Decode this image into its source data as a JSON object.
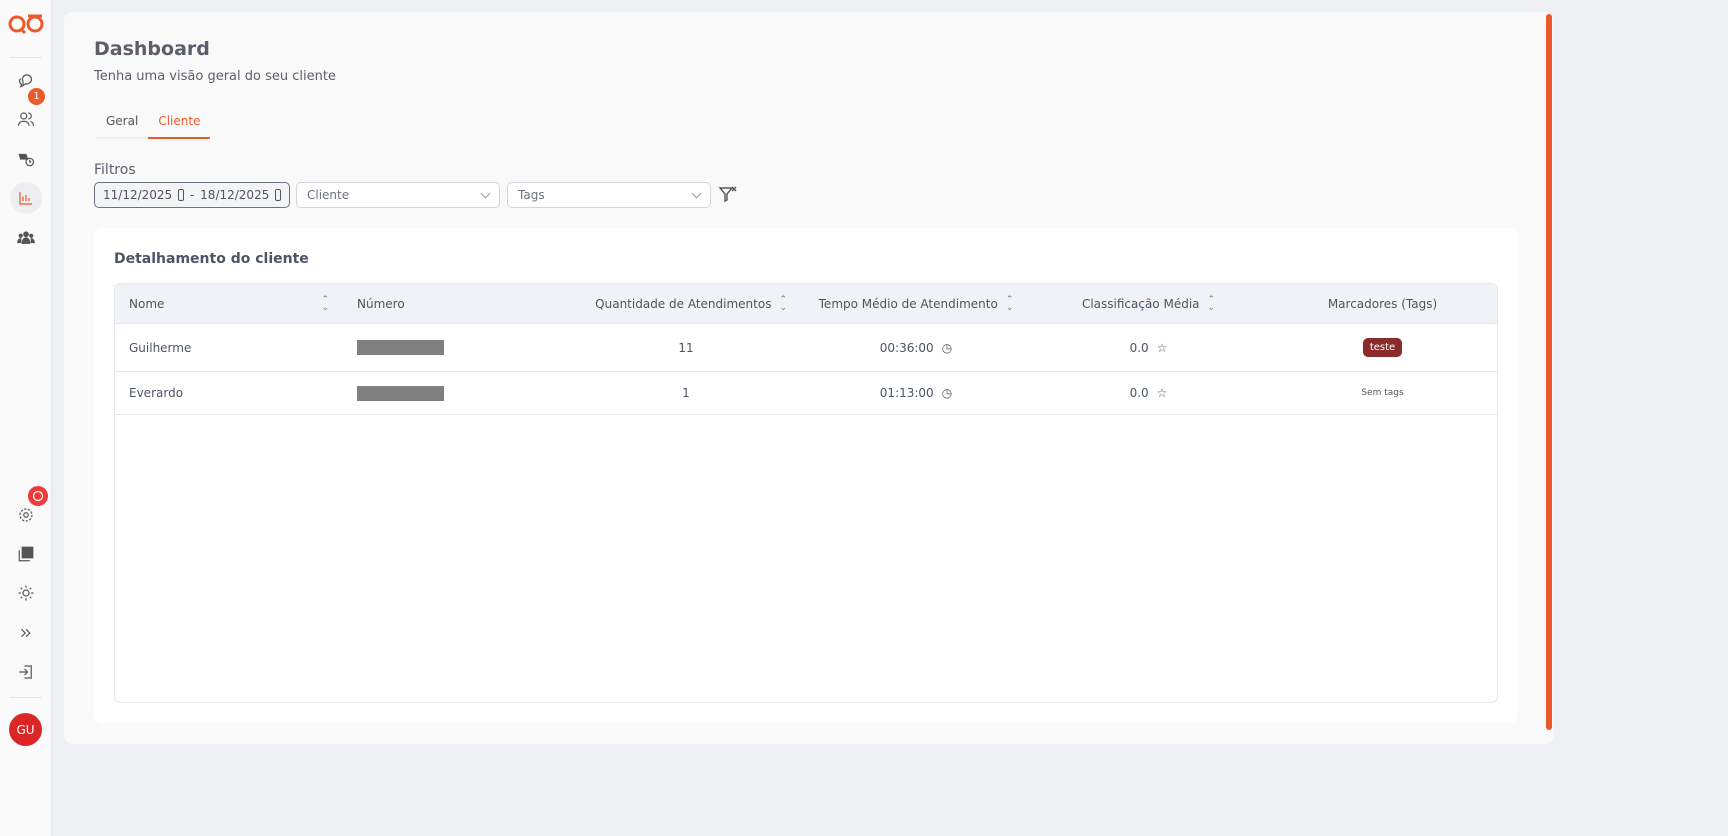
{
  "sidebar": {
    "chat_badge": "1",
    "avatar_initials": "GU"
  },
  "header": {
    "title": "Dashboard",
    "subtitle": "Tenha uma visão geral do seu cliente"
  },
  "tabs": [
    {
      "label": "Geral"
    },
    {
      "label": "Cliente"
    }
  ],
  "filters": {
    "label": "Filtros",
    "date_start": "11/12/2025",
    "date_sep": "-",
    "date_end": "18/12/2025",
    "client_placeholder": "Cliente",
    "tags_placeholder": "Tags"
  },
  "card": {
    "title": "Detalhamento do cliente",
    "columns": [
      "Nome",
      "Número",
      "Quantidade de Atendimentos",
      "Tempo Médio de Atendimento",
      "Classificação Média",
      "Marcadores (Tags)"
    ],
    "rows": [
      {
        "name": "Guilherme",
        "count": "11",
        "avg_time": "00:36:00",
        "rating": "0.0",
        "tag": "teste"
      },
      {
        "name": "Everardo",
        "count": "1",
        "avg_time": "01:13:00",
        "rating": "0.0",
        "tag": "Sem tags"
      }
    ]
  },
  "colors": {
    "accent": "#ea5a2a",
    "tag": "#8b2c2c"
  }
}
